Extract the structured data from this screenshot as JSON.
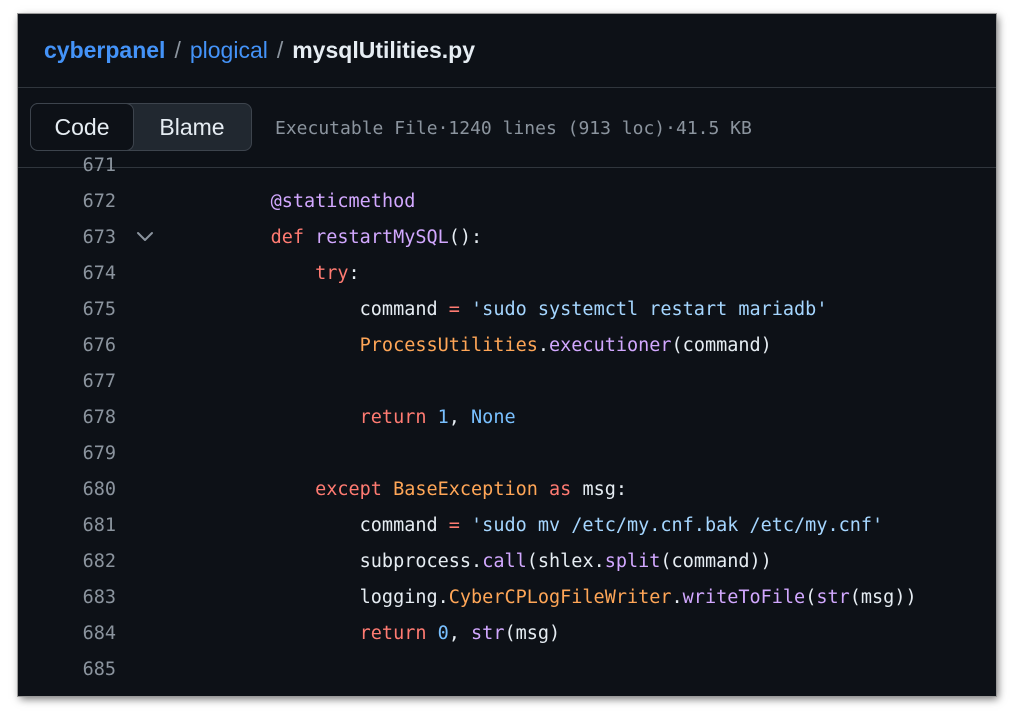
{
  "breadcrumb": {
    "owner": "cyberpanel",
    "folder": "plogical",
    "file": "mysqlUtilities.py",
    "separator": "/"
  },
  "view_toggle": {
    "code_label": "Code",
    "blame_label": "Blame",
    "selected": "Code"
  },
  "file_info": {
    "type": "Executable File",
    "lines": "1240 lines (913 loc)",
    "size": "41.5 KB",
    "dot": "·"
  },
  "code": {
    "language": "python",
    "lines": [
      {
        "num": "671",
        "indent": "",
        "tokens": []
      },
      {
        "num": "672",
        "indent": "    ",
        "tokens": [
          {
            "t": "@staticmethod",
            "c": "f"
          }
        ]
      },
      {
        "num": "673",
        "indent": "    ",
        "fold": true,
        "tokens": [
          {
            "t": "def ",
            "c": "k"
          },
          {
            "t": "restartMySQL",
            "c": "f"
          },
          {
            "t": "():",
            "c": ""
          }
        ]
      },
      {
        "num": "674",
        "indent": "        ",
        "tokens": [
          {
            "t": "try",
            "c": "k"
          },
          {
            "t": ":",
            "c": ""
          }
        ]
      },
      {
        "num": "675",
        "indent": "            ",
        "tokens": [
          {
            "t": "command ",
            "c": ""
          },
          {
            "t": "=",
            "c": "k"
          },
          {
            "t": " ",
            "c": ""
          },
          {
            "t": "'sudo systemctl restart mariadb'",
            "c": "s"
          }
        ]
      },
      {
        "num": "676",
        "indent": "            ",
        "tokens": [
          {
            "t": "ProcessUtilities",
            "c": "cl"
          },
          {
            "t": ".",
            "c": ""
          },
          {
            "t": "executioner",
            "c": "f"
          },
          {
            "t": "(command)",
            "c": ""
          }
        ]
      },
      {
        "num": "677",
        "indent": "",
        "tokens": []
      },
      {
        "num": "678",
        "indent": "            ",
        "tokens": [
          {
            "t": "return ",
            "c": "k"
          },
          {
            "t": "1",
            "c": "c"
          },
          {
            "t": ", ",
            "c": ""
          },
          {
            "t": "None",
            "c": "c"
          }
        ]
      },
      {
        "num": "679",
        "indent": "",
        "tokens": []
      },
      {
        "num": "680",
        "indent": "        ",
        "tokens": [
          {
            "t": "except ",
            "c": "k"
          },
          {
            "t": "BaseException",
            "c": "cl"
          },
          {
            "t": " as ",
            "c": "k"
          },
          {
            "t": "msg:",
            "c": ""
          }
        ]
      },
      {
        "num": "681",
        "indent": "            ",
        "tokens": [
          {
            "t": "command ",
            "c": ""
          },
          {
            "t": "=",
            "c": "k"
          },
          {
            "t": " ",
            "c": ""
          },
          {
            "t": "'sudo mv /etc/my.cnf.bak /etc/my.cnf'",
            "c": "s"
          }
        ]
      },
      {
        "num": "682",
        "indent": "            ",
        "tokens": [
          {
            "t": "subprocess",
            "c": ""
          },
          {
            "t": ".",
            "c": ""
          },
          {
            "t": "call",
            "c": "f"
          },
          {
            "t": "(shlex.",
            "c": ""
          },
          {
            "t": "split",
            "c": "f"
          },
          {
            "t": "(command))",
            "c": ""
          }
        ]
      },
      {
        "num": "683",
        "indent": "            ",
        "tokens": [
          {
            "t": "logging.",
            "c": ""
          },
          {
            "t": "CyberCPLogFileWriter",
            "c": "cl"
          },
          {
            "t": ".",
            "c": ""
          },
          {
            "t": "writeToFile",
            "c": "f"
          },
          {
            "t": "(",
            "c": ""
          },
          {
            "t": "str",
            "c": "f"
          },
          {
            "t": "(msg))",
            "c": ""
          }
        ]
      },
      {
        "num": "684",
        "indent": "            ",
        "tokens": [
          {
            "t": "return ",
            "c": "k"
          },
          {
            "t": "0",
            "c": "c"
          },
          {
            "t": ", ",
            "c": ""
          },
          {
            "t": "str",
            "c": "f"
          },
          {
            "t": "(msg)",
            "c": ""
          }
        ]
      },
      {
        "num": "685",
        "indent": "",
        "tokens": []
      }
    ]
  },
  "colors": {
    "background": "#0d1117",
    "link": "#4493f8",
    "keyword": "#ff7b72",
    "function": "#d2a8ff",
    "string": "#a5d6ff",
    "constant": "#79c0ff",
    "class": "#ffa657",
    "line_number": "#8b949e"
  },
  "icons": {
    "fold": "chevron-down-icon"
  }
}
